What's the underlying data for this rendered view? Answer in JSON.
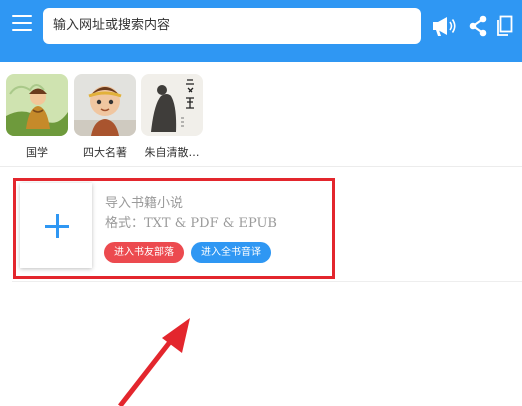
{
  "colors": {
    "topbar": "#2f97f3",
    "highlight": "#e3262d",
    "pill_red": "#ec4a4f",
    "pill_blue": "#2f97f3"
  },
  "toolbar": {
    "menu_icon": "menu-icon",
    "search_placeholder": "输入网址或搜索内容",
    "icons": [
      "megaphone-icon",
      "share-icon",
      "tabs-icon"
    ]
  },
  "books": [
    {
      "label": "国学"
    },
    {
      "label": "四大名著"
    },
    {
      "label": "朱自清散…"
    }
  ],
  "import": {
    "title": "导入书籍小说",
    "formats": "格式：TXT & PDF & EPUB",
    "btn_forum": "进入书友部落",
    "btn_audio": "进入全书音译"
  }
}
